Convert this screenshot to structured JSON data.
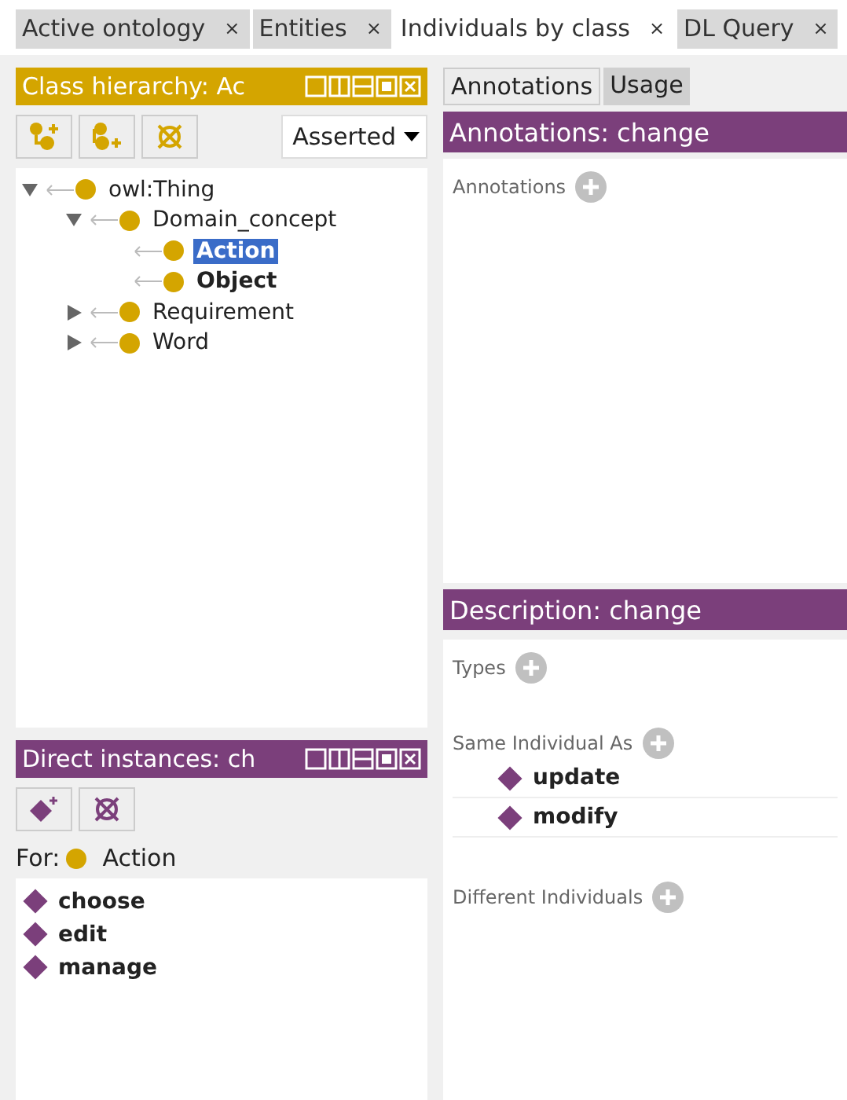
{
  "tabs": [
    {
      "label": "Active ontology",
      "close": "×",
      "selected": false
    },
    {
      "label": "Entities",
      "close": "×",
      "selected": false
    },
    {
      "label": "Individuals by class",
      "close": "×",
      "selected": true
    },
    {
      "label": "DL Query",
      "close": "×",
      "selected": false
    }
  ],
  "class_hierarchy": {
    "title": "Class hierarchy: Ac",
    "dropdown": "Asserted",
    "tree": [
      {
        "label": "owl:Thing",
        "expanded": true,
        "selected": false,
        "bold": false,
        "children": [
          {
            "label": "Domain_concept",
            "expanded": true,
            "selected": false,
            "bold": false,
            "children": [
              {
                "label": "Action",
                "selected": true,
                "bold": true
              },
              {
                "label": "Object",
                "selected": false,
                "bold": true
              }
            ]
          },
          {
            "label": "Requirement",
            "expanded": false,
            "selected": false,
            "bold": false
          },
          {
            "label": "Word",
            "expanded": false,
            "selected": false,
            "bold": false
          }
        ]
      }
    ]
  },
  "direct_instances": {
    "title": "Direct instances: ch",
    "for_label": "For:",
    "for_class": "Action",
    "items": [
      "choose",
      "edit",
      "manage"
    ]
  },
  "right_tabs": [
    {
      "label": "Annotations",
      "selected": true
    },
    {
      "label": "Usage",
      "selected": false
    }
  ],
  "annotations": {
    "title": "Annotations: change",
    "section": "Annotations"
  },
  "description": {
    "title": "Description: change",
    "sections": [
      {
        "label": "Types"
      },
      {
        "label": "Same Individual As",
        "items": [
          "update",
          "modify"
        ]
      },
      {
        "label": "Different Individuals"
      }
    ]
  }
}
